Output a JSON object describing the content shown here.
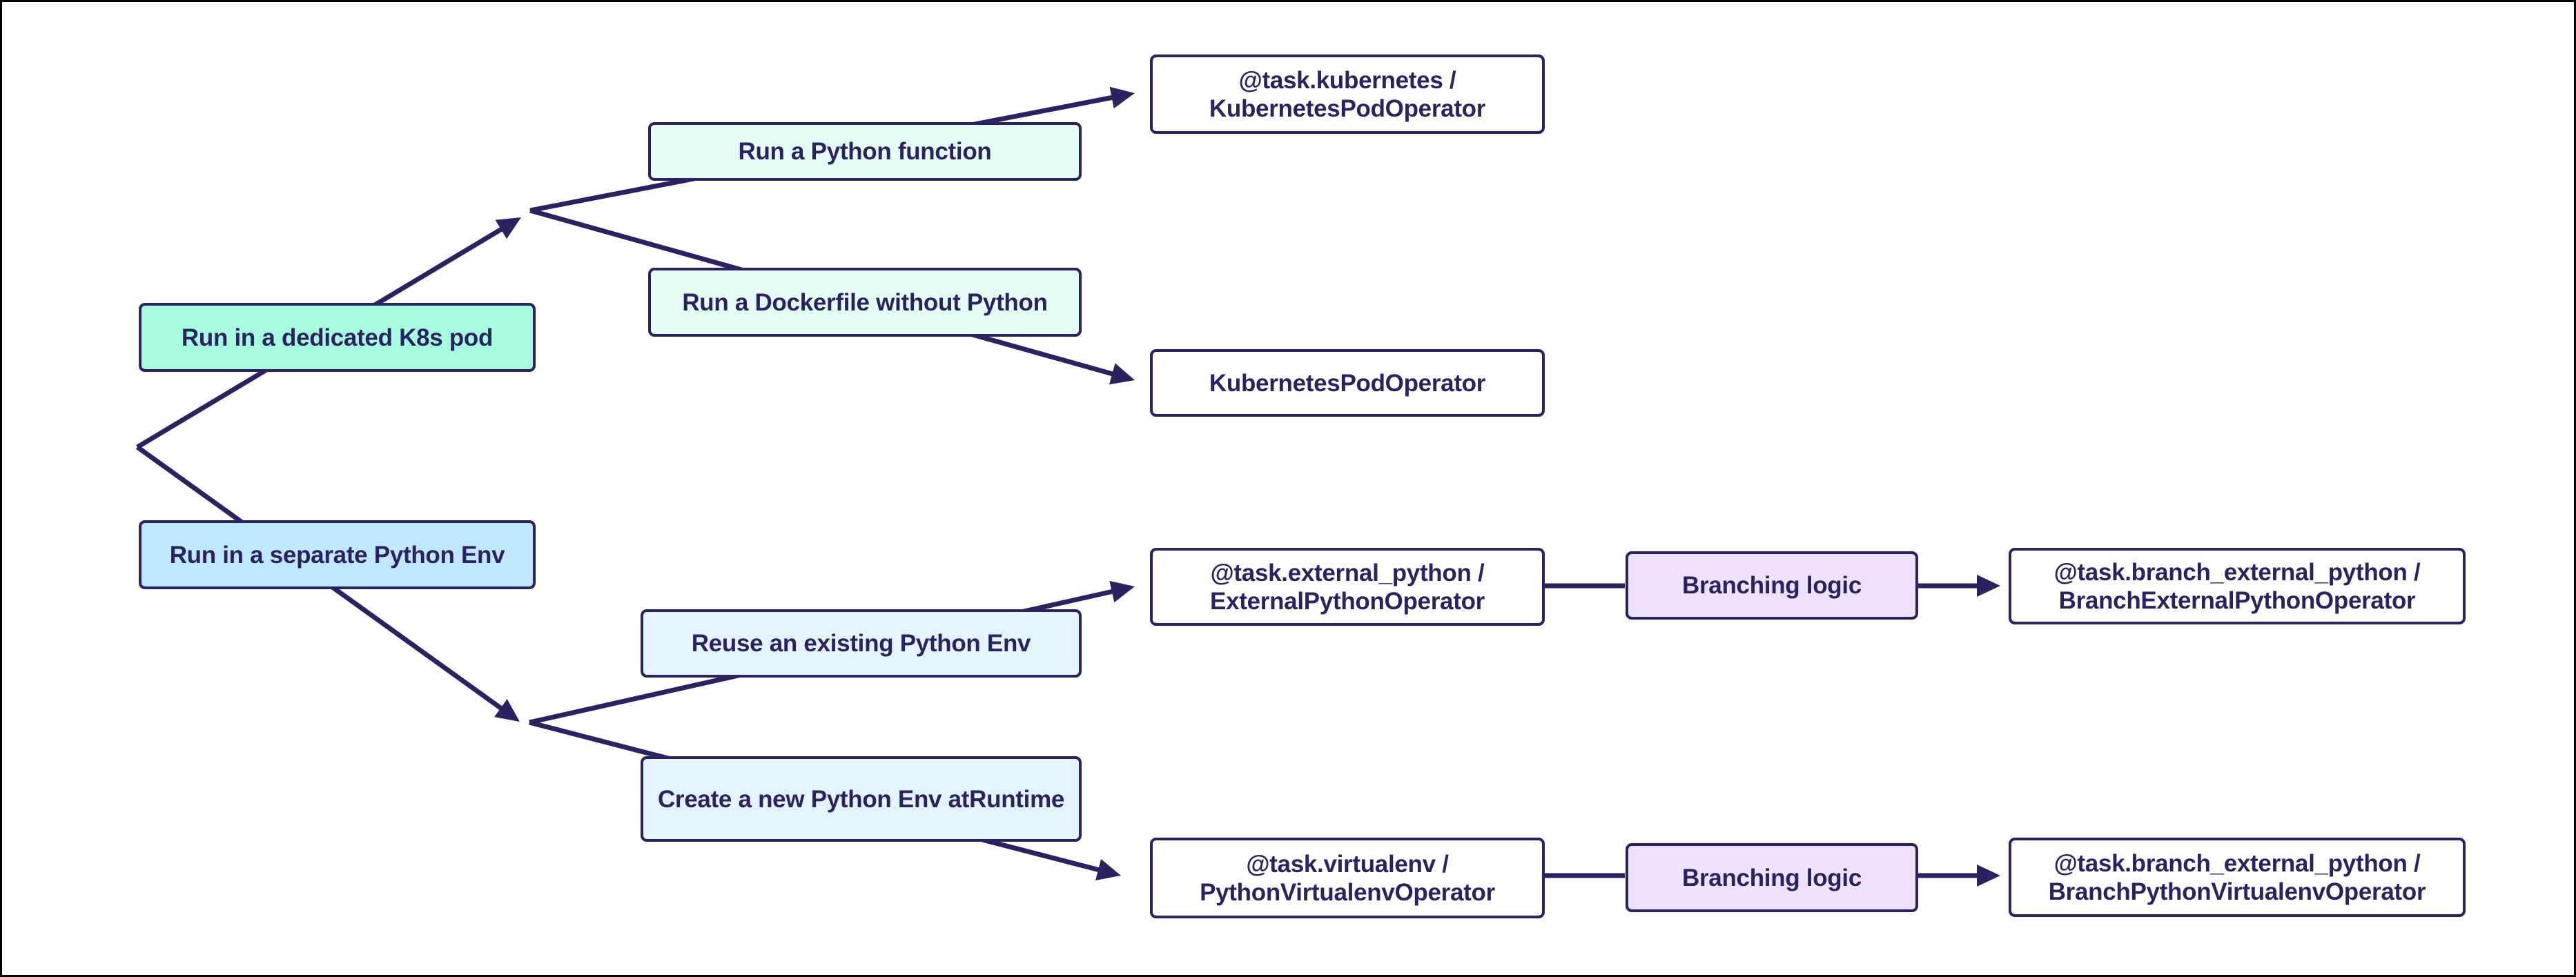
{
  "diagram": {
    "colors": {
      "stroke": "#2B2360",
      "text": "#2B2360",
      "k8s_fill": "#A7FEDE",
      "k8s_child_fill": "#E4FDF5",
      "pyenv_fill": "#C0E8FD",
      "pyenv_child_fill": "#E3F4FD",
      "operator_fill": "#FFFFFF",
      "branching_fill": "#EFE2FE"
    },
    "nodes": {
      "k8s_pod": "Run in a dedicated K8s pod",
      "python_env": "Run in a separate Python Env",
      "python_function": "Run a Python function",
      "dockerfile": "Run a Dockerfile without Python",
      "reuse_env": "Reuse an existing Python Env",
      "create_env": "Create a new Python Env at Runtime",
      "task_kubernetes": "@task.kubernetes / KubernetesPodOperator",
      "kpo": "KubernetesPodOperator",
      "task_external_python": "@task.external_python / ExternalPythonOperator",
      "task_virtualenv": "@task.virtualenv / PythonVirtualenvOperator",
      "branching_1": "Branching logic",
      "branching_2": "Branching logic",
      "branch_external": "@task.branch_external_python / BranchExternalPythonOperator",
      "branch_virtualenv": "@task.branch_external_python / BranchPythonVirtualenvOperator"
    },
    "node_lines": {
      "task_kubernetes": [
        "@task.kubernetes /",
        "KubernetesPodOperator"
      ],
      "task_external_python": [
        "@task.external_python /",
        "ExternalPythonOperator"
      ],
      "task_virtualenv": [
        "@task.virtualenv /",
        "PythonVirtualenvOperator"
      ],
      "branch_external": [
        "@task.branch_external_python /",
        "BranchExternalPythonOperator"
      ],
      "branch_virtualenv": [
        "@task.branch_external_python /",
        "BranchPythonVirtualenvOperator"
      ],
      "create_env": [
        "Create a new Python Env at",
        "Runtime"
      ]
    },
    "edges": [
      {
        "from": "root",
        "to": "k8s_fork",
        "via": "k8s_pod",
        "arrow": true
      },
      {
        "from": "root",
        "to": "pyenv_fork",
        "via": "python_env",
        "arrow": true
      },
      {
        "from": "k8s_fork",
        "to": "task_kubernetes",
        "via": "python_function",
        "arrow": true
      },
      {
        "from": "k8s_fork",
        "to": "kpo",
        "via": "dockerfile",
        "arrow": true
      },
      {
        "from": "pyenv_fork",
        "to": "task_external_python",
        "via": "reuse_env",
        "arrow": true
      },
      {
        "from": "pyenv_fork",
        "to": "task_virtualenv",
        "via": "create_env",
        "arrow": true
      },
      {
        "from": "task_external_python",
        "to": "branching_1",
        "arrow": false
      },
      {
        "from": "branching_1",
        "to": "branch_external",
        "arrow": true
      },
      {
        "from": "task_virtualenv",
        "to": "branching_2",
        "arrow": false
      },
      {
        "from": "branching_2",
        "to": "branch_virtualenv",
        "arrow": true
      }
    ]
  }
}
